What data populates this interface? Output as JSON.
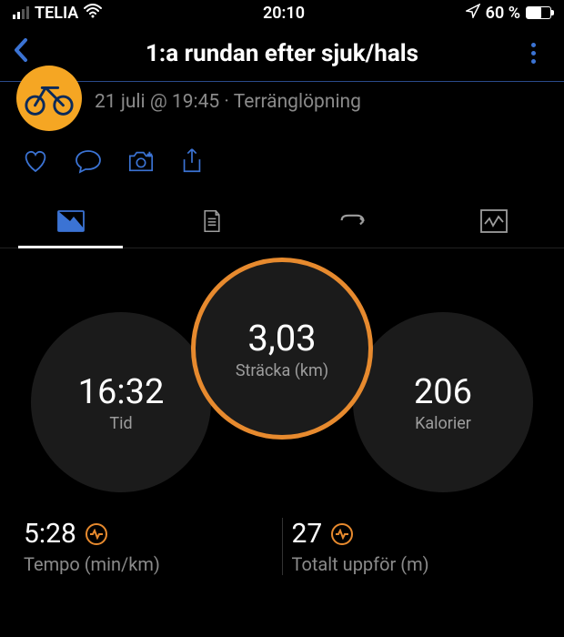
{
  "status": {
    "carrier": "TELIA",
    "time": "20:10",
    "battery_pct": "60 %"
  },
  "nav": {
    "title": "1:a rundan efter sjuk/hals"
  },
  "subtitle": "21 juli @ 19:45 · Terränglöpning",
  "rings": {
    "center": {
      "value": "3,03",
      "label": "Sträcka (km)"
    },
    "left": {
      "value": "16:32",
      "label": "Tid"
    },
    "right": {
      "value": "206",
      "label": "Kalorier"
    }
  },
  "colors": {
    "accent_blue": "#3b73d4",
    "ring_orange": "#e78a2e",
    "ring_green": "#3bd46a",
    "ring_blue": "#4a6cf0",
    "ring_purple": "#7a4af0"
  },
  "bottom": {
    "pace": {
      "value": "5:28",
      "label": "Tempo (min/km)"
    },
    "elev": {
      "value": "27",
      "label": "Totalt uppför (m)"
    }
  }
}
